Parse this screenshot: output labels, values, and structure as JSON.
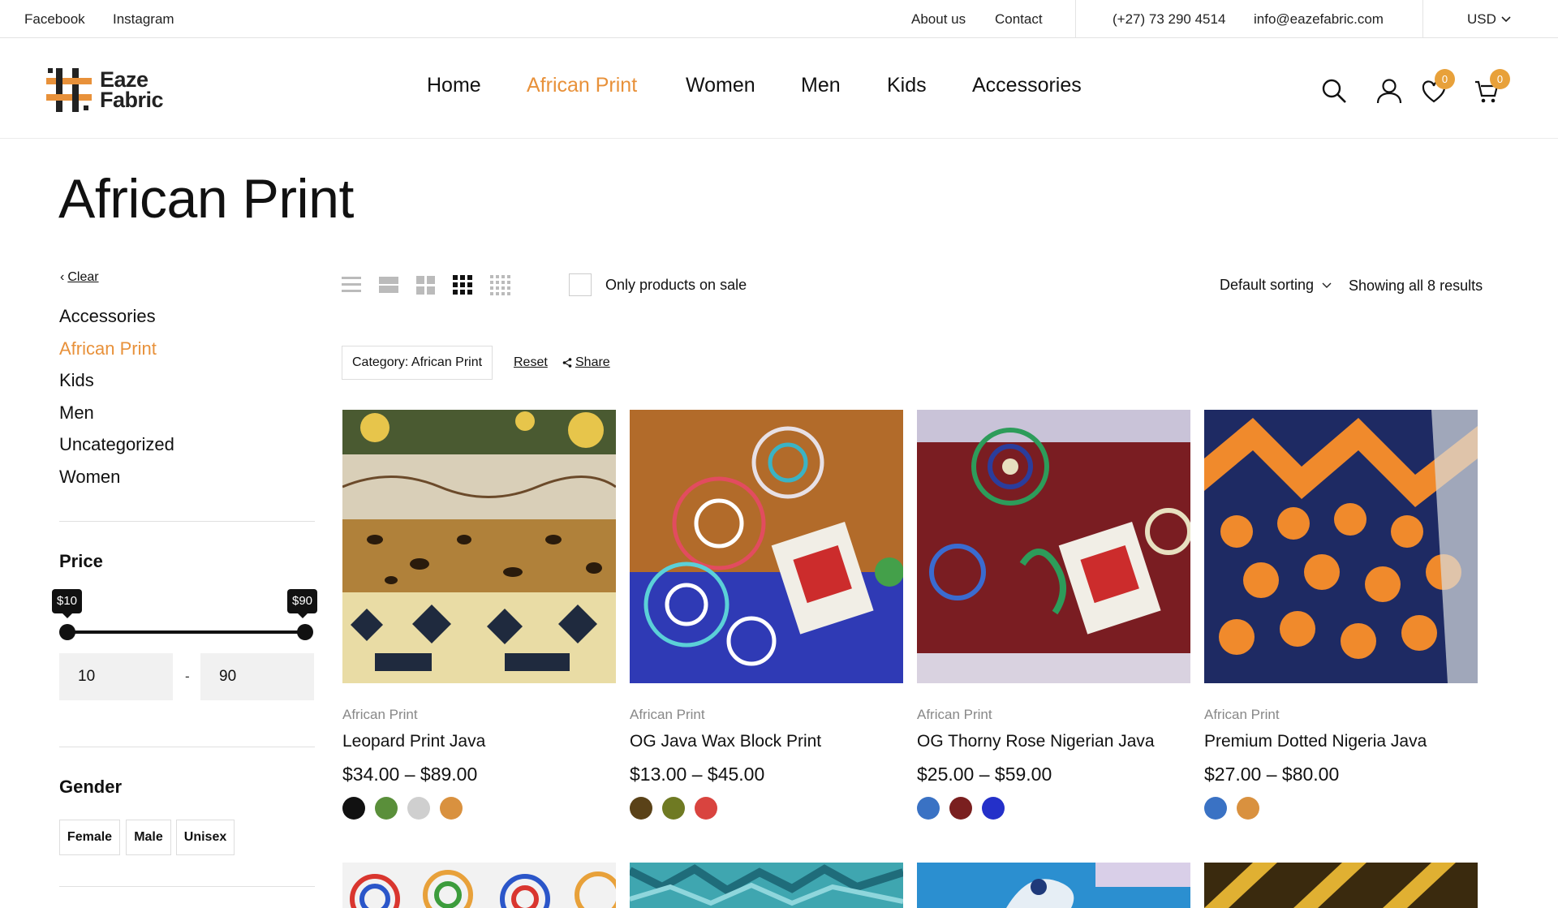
{
  "topbar": {
    "facebook": "Facebook",
    "instagram": "Instagram",
    "about": "About us",
    "contact": "Contact",
    "phone": "(+27) 73 290 4514",
    "email": "info@eazefabric.com",
    "currency": "USD"
  },
  "header": {
    "logo_line1": "Eaze",
    "logo_line2": "Fabric",
    "nav": [
      "Home",
      "African Print",
      "Women",
      "Men",
      "Kids",
      "Accessories"
    ],
    "active_nav": "African Print",
    "wishlist_count": "0",
    "cart_count": "0",
    "icons": [
      "search-icon",
      "user-icon",
      "heart-icon",
      "cart-icon"
    ]
  },
  "page": {
    "title": "African Print"
  },
  "sidebar": {
    "clear": "Clear",
    "categories": [
      "Accessories",
      "African Print",
      "Kids",
      "Men",
      "Uncategorized",
      "Women"
    ],
    "active_category": "African Print",
    "price": {
      "heading": "Price",
      "min_tip": "$10",
      "max_tip": "$90",
      "min_value": "10",
      "max_value": "90",
      "dash": "-"
    },
    "gender": {
      "heading": "Gender",
      "options": [
        "Female",
        "Male",
        "Unisex"
      ]
    }
  },
  "toolbar": {
    "view_modes": [
      "list-view-icon",
      "two-column-icon",
      "three-column-icon",
      "four-column-icon",
      "five-column-icon"
    ],
    "active_view": "four-column-icon",
    "sale_label": "Only products on sale",
    "sorting": "Default sorting",
    "results": "Showing all 8 results"
  },
  "filters": {
    "chip": "Category: African Print",
    "reset": "Reset",
    "share": "Share"
  },
  "products": [
    {
      "category": "African Print",
      "title": "Leopard Print Java",
      "price": "$34.00 – $89.00",
      "swatches": [
        "#111111",
        "#5a8f3a",
        "#cfcfcf",
        "#d9913f"
      ]
    },
    {
      "category": "African Print",
      "title": "OG Java Wax Block Print",
      "price": "$13.00 – $45.00",
      "swatches": [
        "#5a4218",
        "#6f7a23",
        "#d9443f"
      ]
    },
    {
      "category": "African Print",
      "title": "OG Thorny Rose Nigerian Java",
      "price": "$25.00 – $59.00",
      "swatches": [
        "#3a72c4",
        "#7a1f1f",
        "#2430c9"
      ]
    },
    {
      "category": "African Print",
      "title": "Premium Dotted Nigeria Java",
      "price": "$27.00 – $80.00",
      "swatches": [
        "#3a72c4",
        "#d9913f"
      ]
    }
  ],
  "colors": {
    "accent": "#e8913a",
    "badge": "#e8a13a"
  }
}
